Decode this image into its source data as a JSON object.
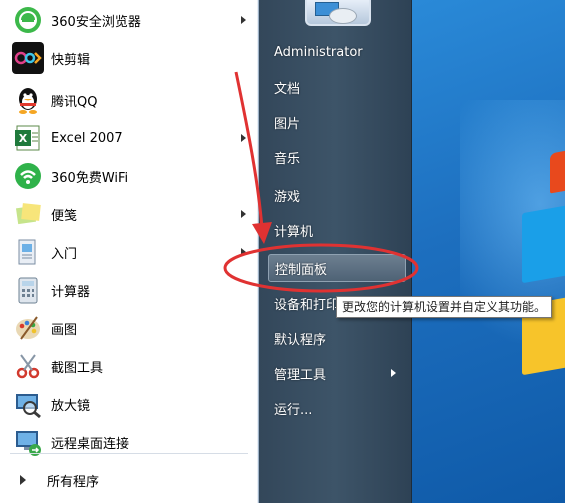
{
  "pinned_programs": [
    {
      "label": "360安全浏览器",
      "icon": "browser-360-icon",
      "has_submenu": true
    },
    {
      "label": "快剪辑",
      "icon": "video-editor-icon",
      "has_submenu": false
    },
    {
      "label": "腾讯QQ",
      "icon": "qq-penguin-icon",
      "has_submenu": false
    },
    {
      "label": "Excel 2007",
      "icon": "excel-icon",
      "has_submenu": true
    },
    {
      "label": "360免费WiFi",
      "icon": "wifi-360-icon",
      "has_submenu": false
    },
    {
      "label": "便笺",
      "icon": "sticky-notes-icon",
      "has_submenu": true
    },
    {
      "label": "入门",
      "icon": "getting-started-icon",
      "has_submenu": true
    },
    {
      "label": "计算器",
      "icon": "calculator-icon",
      "has_submenu": false
    },
    {
      "label": "画图",
      "icon": "paint-palette-icon",
      "has_submenu": false
    },
    {
      "label": "截图工具",
      "icon": "scissors-icon",
      "has_submenu": false
    },
    {
      "label": "放大镜",
      "icon": "magnifier-icon",
      "has_submenu": false
    },
    {
      "label": "远程桌面连接",
      "icon": "remote-desktop-icon",
      "has_submenu": false
    }
  ],
  "all_programs_label": "所有程序",
  "right_menu": [
    {
      "label": "Administrator",
      "has_submenu": false,
      "highlighted": false
    },
    {
      "label": "文档",
      "has_submenu": false,
      "highlighted": false
    },
    {
      "label": "图片",
      "has_submenu": false,
      "highlighted": false
    },
    {
      "label": "音乐",
      "has_submenu": false,
      "highlighted": false
    },
    {
      "label": "游戏",
      "has_submenu": false,
      "highlighted": false
    },
    {
      "label": "计算机",
      "has_submenu": false,
      "highlighted": false
    },
    {
      "label": "控制面板",
      "has_submenu": false,
      "highlighted": true
    },
    {
      "label": "设备和打印机",
      "has_submenu": false,
      "highlighted": false
    },
    {
      "label": "默认程序",
      "has_submenu": false,
      "highlighted": false
    },
    {
      "label": "管理工具",
      "has_submenu": true,
      "highlighted": false
    },
    {
      "label": "运行...",
      "has_submenu": false,
      "highlighted": false
    }
  ],
  "tooltip": "更改您的计算机设置并自定义其功能。",
  "colors": {
    "annotation_red": "#e03232",
    "right_pane": "#3d5468",
    "desktop_blue": "#1d6fbf"
  }
}
